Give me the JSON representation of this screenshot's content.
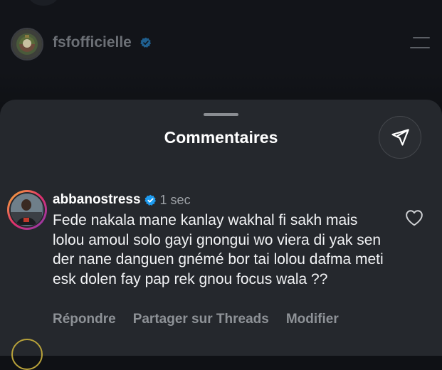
{
  "post": {
    "username": "fsfofficielle",
    "verified": true
  },
  "sheet": {
    "title": "Commentaires"
  },
  "comment": {
    "username": "abbanostress",
    "verified": true,
    "time": "1 sec",
    "text": "Fede nakala mane kanlay wakhal fi sakh mais lolou amoul solo gayi gnongui wo viera di yak sen der nane danguen gnémé bor tai lolou dafma meti esk dolen fay pap rek gnou focus wala ??",
    "actions": {
      "reply": "Répondre",
      "share_threads": "Partager sur Threads",
      "edit": "Modifier"
    }
  },
  "icons": {
    "verified": "verified-badge-icon",
    "share": "paper-plane-icon",
    "like": "heart-icon",
    "menu": "menu-icon"
  },
  "colors": {
    "sheet_bg": "#25282d",
    "page_bg": "#0f1115",
    "verified_blue": "#1d9bf0",
    "muted_text": "#8e9297"
  }
}
